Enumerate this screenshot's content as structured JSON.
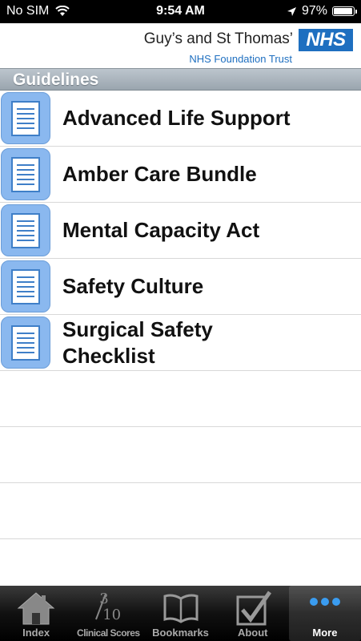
{
  "status": {
    "carrier": "No SIM",
    "time": "9:54 AM",
    "battery": "97%",
    "battery_level": 0.97
  },
  "brand": {
    "org": "Guy’s and St Thomas’",
    "trust": "NHS Foundation Trust",
    "logo": "NHS"
  },
  "section": {
    "title": "Guidelines"
  },
  "items": [
    {
      "label": "Advanced Life Support",
      "icon": "document-icon"
    },
    {
      "label": "Amber Care Bundle",
      "icon": "document-icon"
    },
    {
      "label": "Mental Capacity Act",
      "icon": "document-icon"
    },
    {
      "label": "Safety Culture",
      "icon": "document-icon"
    },
    {
      "label": "Surgical Safety Checklist",
      "icon": "document-icon"
    }
  ],
  "tabs": [
    {
      "label": "Index",
      "icon": "house-icon"
    },
    {
      "label": "Clinical Scores",
      "icon": "fraction-icon",
      "numerator": "3",
      "denominator": "10"
    },
    {
      "label": "Bookmarks",
      "icon": "book-icon"
    },
    {
      "label": "About",
      "icon": "checkbox-icon"
    },
    {
      "label": "More",
      "icon": "ellipsis-icon",
      "active": true
    }
  ],
  "colors": {
    "nhs_blue": "#1e6fc0",
    "tile_blue": "#8ab8ef",
    "header_grey": "#aab3bb"
  }
}
